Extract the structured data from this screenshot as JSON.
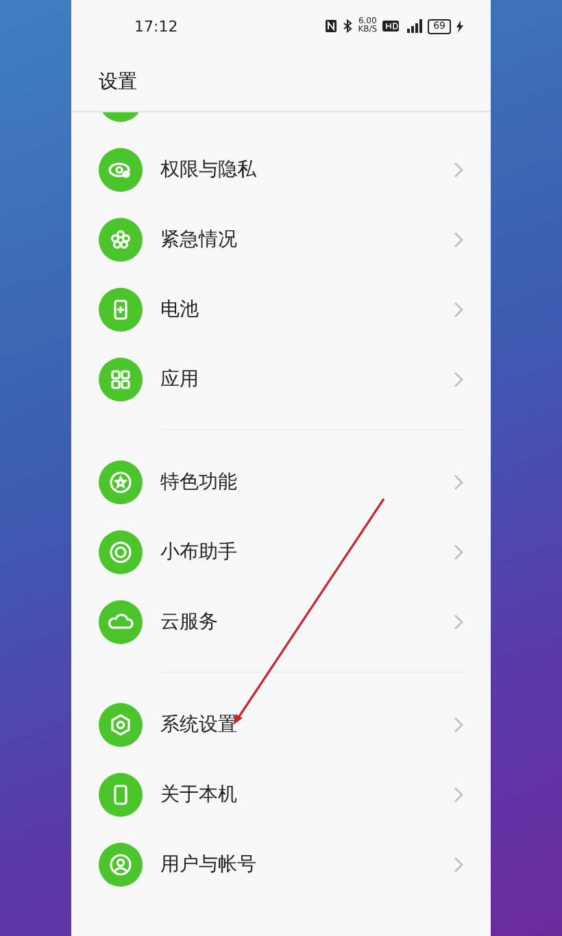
{
  "status_bar": {
    "time": "17:12",
    "network_speed": "6.00",
    "network_speed_unit": "KB/S",
    "battery": "69"
  },
  "header": {
    "title": "设置"
  },
  "groups": [
    {
      "items": [
        {
          "label": "权限与隐私"
        },
        {
          "label": "紧急情况"
        },
        {
          "label": "电池"
        },
        {
          "label": "应用"
        }
      ]
    },
    {
      "items": [
        {
          "label": "特色功能"
        },
        {
          "label": "小布助手"
        },
        {
          "label": "云服务"
        }
      ]
    },
    {
      "items": [
        {
          "label": "系统设置"
        },
        {
          "label": "关于本机"
        },
        {
          "label": "用户与帐号"
        }
      ]
    }
  ]
}
